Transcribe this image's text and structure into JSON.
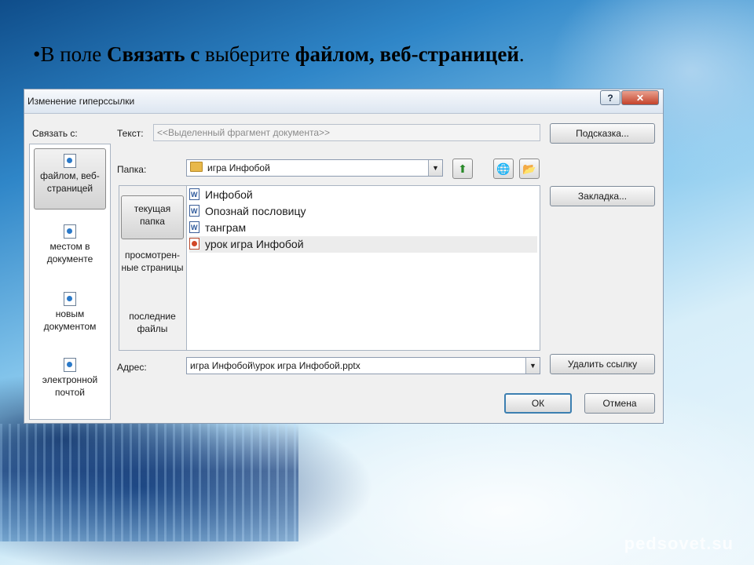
{
  "slide": {
    "heading_parts": [
      "В поле ",
      "Связать с",
      " выберите ",
      "файлом, веб-страницей",
      "."
    ],
    "watermark": "pedsovet.su"
  },
  "dialog": {
    "title": "Изменение гиперссылки",
    "help_button": "?",
    "close_button": "✕",
    "link_to_label": "Связать с:",
    "link_to_items": [
      {
        "label": "файлом, веб-страницей",
        "icon": "web-page-icon",
        "active": true
      },
      {
        "label": "местом в документе",
        "icon": "document-place-icon",
        "active": false
      },
      {
        "label": "новым документом",
        "icon": "new-document-icon",
        "active": false
      },
      {
        "label": "электронной почтой",
        "icon": "email-icon",
        "active": false
      }
    ],
    "text_label": "Текст:",
    "text_value": "<<Выделенный фрагмент документа>>",
    "screentip_button": "Подсказка...",
    "folder_label": "Папка:",
    "folder_value": "игра Инфобой",
    "nav_items": [
      {
        "label": "текущая папка",
        "active": true
      },
      {
        "label": "просмотрен-ные страницы",
        "active": false
      },
      {
        "label": "последние файлы",
        "active": false
      }
    ],
    "files": [
      {
        "name": "Инфобой",
        "type": "word",
        "selected": false
      },
      {
        "name": "Опознай пословицу",
        "type": "word",
        "selected": false
      },
      {
        "name": "танграм",
        "type": "word",
        "selected": false
      },
      {
        "name": "урок игра Инфобой",
        "type": "ppt",
        "selected": true
      }
    ],
    "bookmark_button": "Закладка...",
    "address_label": "Адрес:",
    "address_value": "игра Инфобой\\урок игра Инфобой.pptx",
    "remove_link_button": "Удалить ссылку",
    "ok_button": "ОК",
    "cancel_button": "Отмена"
  }
}
